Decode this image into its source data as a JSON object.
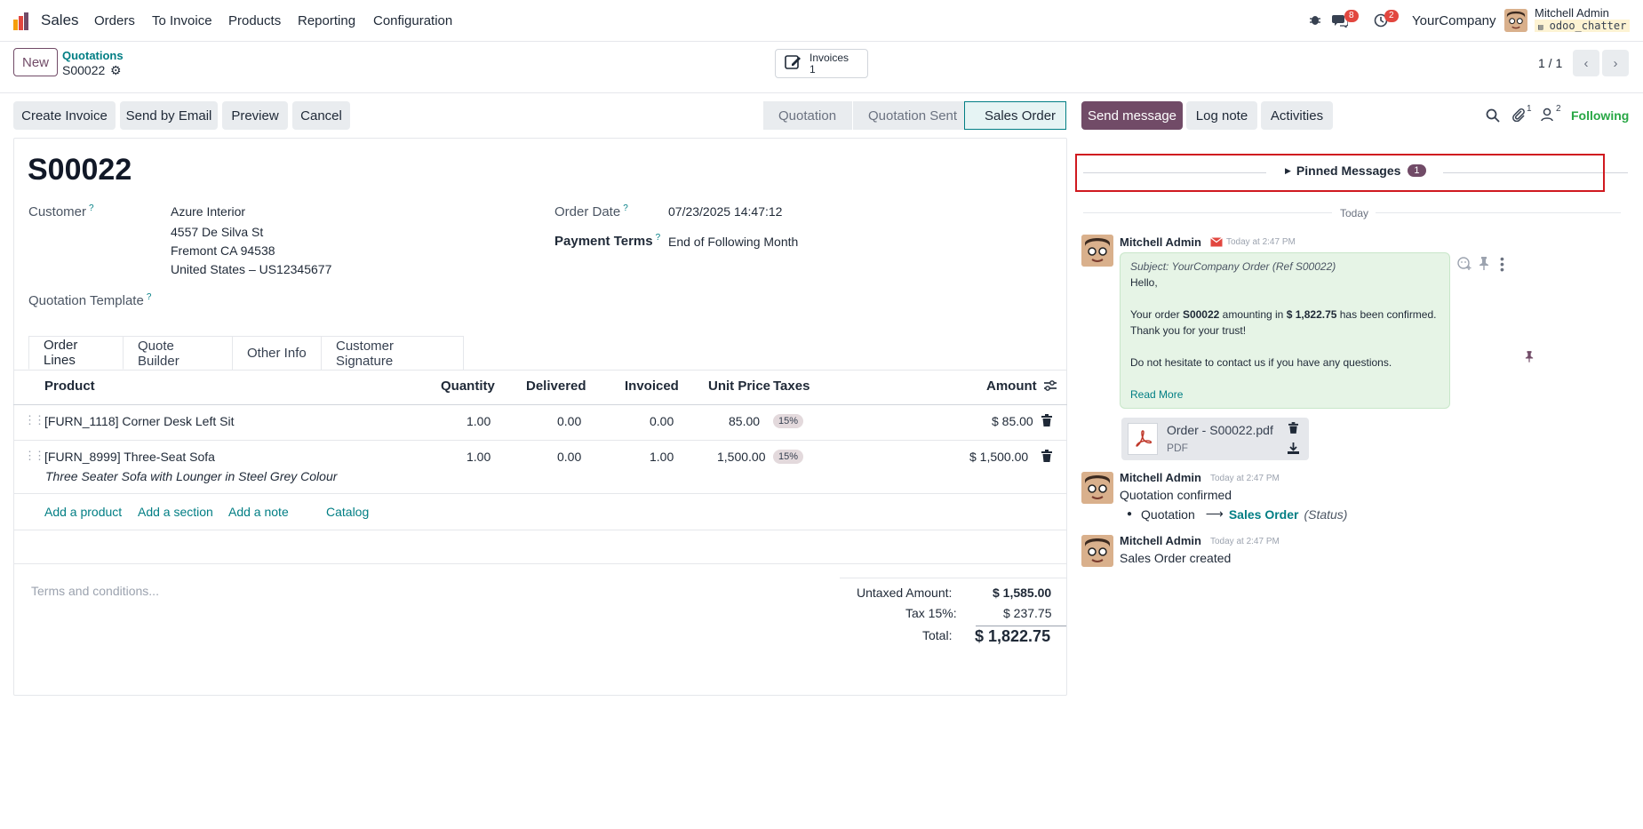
{
  "navbar": {
    "app_name": "Sales",
    "menu": [
      "Orders",
      "To Invoice",
      "Products",
      "Reporting",
      "Configuration"
    ],
    "messages_count": "8",
    "activities_count": "2",
    "company": "YourCompany",
    "user_name": "Mitchell Admin",
    "db_name": "odoo_chatter"
  },
  "control": {
    "new_label": "New",
    "breadcrumb_parent": "Quotations",
    "breadcrumb_current": "S00022",
    "smart_button_label": "Invoices",
    "smart_button_count": "1",
    "pager": "1 / 1"
  },
  "actions": [
    "Create Invoice",
    "Send by Email",
    "Preview",
    "Cancel"
  ],
  "stages": [
    "Quotation",
    "Quotation Sent",
    "Sales Order"
  ],
  "active_stage": "Sales Order",
  "order": {
    "name": "S00022",
    "customer_label": "Customer",
    "customer_name": "Azure Interior",
    "address_line1": "4557 De Silva St",
    "address_line2": "Fremont CA 94538",
    "address_line3": "United States – US12345677",
    "template_label": "Quotation Template",
    "order_date_label": "Order Date",
    "order_date": "07/23/2025 14:47:12",
    "payment_terms_label": "Payment Terms",
    "payment_terms": "End of Following Month",
    "help_mark": "?"
  },
  "tabs": [
    "Order Lines",
    "Quote Builder",
    "Other Info",
    "Customer Signature"
  ],
  "table": {
    "headers": [
      "Product",
      "Quantity",
      "Delivered",
      "Invoiced",
      "Unit Price",
      "Taxes",
      "Amount"
    ],
    "rows": [
      {
        "product": "[FURN_1118] Corner Desk Left Sit",
        "quantity": "1.00",
        "delivered": "0.00",
        "invoiced": "0.00",
        "unit_price": "85.00",
        "tax": "15%",
        "amount": "$ 85.00",
        "description": ""
      },
      {
        "product": "[FURN_8999] Three-Seat Sofa",
        "quantity": "1.00",
        "delivered": "0.00",
        "invoiced": "1.00",
        "unit_price": "1,500.00",
        "tax": "15%",
        "amount": "$ 1,500.00",
        "description": "Three Seater Sofa with Lounger in Steel Grey Colour"
      }
    ],
    "add_links": [
      "Add a product",
      "Add a section",
      "Add a note",
      "Catalog"
    ]
  },
  "totals": {
    "terms_placeholder": "Terms and conditions...",
    "untaxed_label": "Untaxed Amount:",
    "untaxed_value": "$ 1,585.00",
    "tax_label": "Tax 15%:",
    "tax_value": "$ 237.75",
    "total_label": "Total:",
    "total_value": "$ 1,822.75"
  },
  "chatter": {
    "send_message": "Send message",
    "log_note": "Log note",
    "activities": "Activities",
    "attachments_count": "1",
    "followers_count": "2",
    "following": "Following",
    "pinned_label": "Pinned Messages",
    "pinned_count": "1",
    "date_separator": "Today",
    "messages": [
      {
        "author": "Mitchell Admin",
        "time": "Today at 2:47 PM",
        "subject": "Subject: YourCompany Order (Ref S00022)",
        "greeting": "Hello,",
        "body_prefix": "Your order ",
        "body_order": "S00022",
        "body_mid": " amounting in ",
        "body_amount": "$ 1,822.75",
        "body_suffix": " has been confirmed.",
        "thanks": "Thank you for your trust!",
        "contact": "Do not hesitate to contact us if you have any questions.",
        "read_more": "Read More",
        "attachment_name": "Order - S00022.pdf",
        "attachment_type": "PDF"
      },
      {
        "author": "Mitchell Admin",
        "time": "Today at 2:47 PM",
        "text": "Quotation confirmed",
        "tracking_old": "Quotation",
        "tracking_arrow": "⟶",
        "tracking_new": "Sales Order",
        "tracking_field": "(Status)"
      },
      {
        "author": "Mitchell Admin",
        "time": "Today at 2:47 PM",
        "text": "Sales Order created"
      }
    ]
  },
  "colors": {
    "brand": "#714b67",
    "teal": "#017e84",
    "highlight_box": "#d0191f",
    "message_bg": "#e6f4e6"
  }
}
